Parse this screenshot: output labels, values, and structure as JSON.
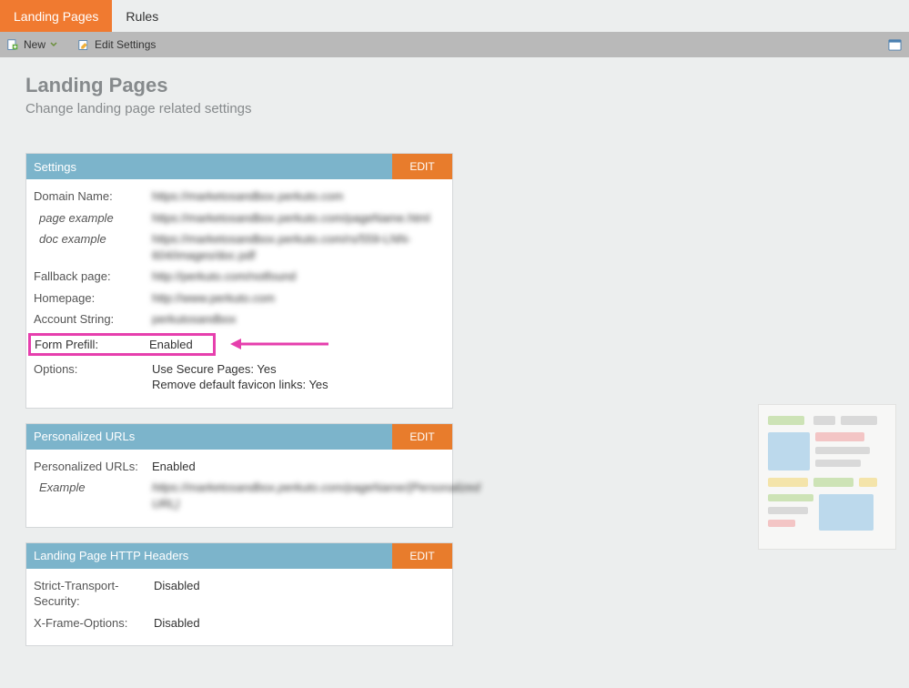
{
  "tabs": {
    "landing": "Landing Pages",
    "rules": "Rules"
  },
  "toolbar": {
    "new": "New",
    "edit": "Edit Settings"
  },
  "page": {
    "title": "Landing Pages",
    "subtitle": "Change landing page related settings"
  },
  "editLabel": "EDIT",
  "panels": {
    "settings": {
      "title": "Settings",
      "domain": {
        "label": "Domain Name:",
        "value": "https://marketosandbox.perkuto.com"
      },
      "pageEx": {
        "label": "page example",
        "value": "https://marketosandbox.perkuto.com/pageName.html"
      },
      "docEx": {
        "label": "doc example",
        "value": "https://marketosandbox.perkuto.com/rs/559-LNN-604/images/doc.pdf"
      },
      "fallback": {
        "label": "Fallback page:",
        "value": "http://perkuto.com/notfound"
      },
      "homepage": {
        "label": "Homepage:",
        "value": "http://www.perkuto.com"
      },
      "account": {
        "label": "Account String:",
        "value": "perkutosandbox"
      },
      "prefill": {
        "label": "Form Prefill:",
        "value": "Enabled"
      },
      "options": {
        "label": "Options:",
        "line1": "Use Secure Pages: Yes",
        "line2": "Remove default favicon links: Yes"
      }
    },
    "purls": {
      "title": "Personalized URLs",
      "enabled": {
        "label": "Personalized URLs:",
        "value": "Enabled"
      },
      "example": {
        "label": "Example",
        "value": "https://marketosandbox.perkuto.com/pageName/{Personalized URL}"
      }
    },
    "headers": {
      "title": "Landing Page HTTP Headers",
      "sts": {
        "label": "Strict-Transport-Security:",
        "value": "Disabled"
      },
      "xfo": {
        "label": "X-Frame-Options:",
        "value": "Disabled"
      }
    }
  }
}
